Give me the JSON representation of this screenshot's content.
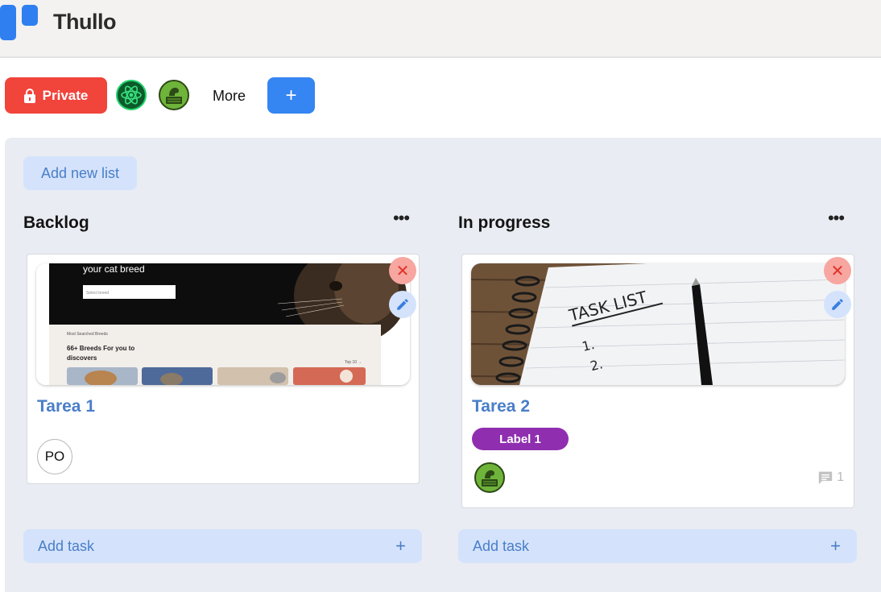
{
  "app": {
    "title": "Thullo"
  },
  "toolbar": {
    "visibility_label": "Private",
    "more_label": "More",
    "add_label": "+"
  },
  "board": {
    "add_list_label": "Add new list",
    "lists": [
      {
        "title": "Backlog",
        "menu": "•••",
        "cards": [
          {
            "title": "Tarea 1",
            "cover_text": {
              "headline": "your cat breed",
              "select": "Select breed",
              "section": "Most Searched Breeds",
              "subhead_1": "66+ Breeds For you to",
              "subhead_2": "discovers",
              "link": "Top 10 →"
            },
            "assignee_initials": "PO"
          }
        ],
        "add_task_label": "Add task",
        "add_task_icon": "+"
      },
      {
        "title": "In progress",
        "menu": "•••",
        "cards": [
          {
            "title": "Tarea 2",
            "cover_text": {
              "heading": "TASK LIST",
              "item_1": "1.",
              "item_2": "2."
            },
            "label": "Label 1",
            "comment_count": "1"
          }
        ],
        "add_task_label": "Add task",
        "add_task_icon": "+"
      }
    ]
  },
  "colors": {
    "brand": "#2f7ff0",
    "private": "#f1443b",
    "label": "#8f2fb0",
    "link": "#4a7ec9",
    "soft_blue": "#d4e3fb",
    "delete": "#f7a6a0"
  },
  "icons": [
    "logo-icon",
    "lock-icon",
    "react-avatar",
    "dragon-avatar",
    "close-icon",
    "pencil-icon",
    "comment-icon",
    "more-icon",
    "plus-icon"
  ]
}
